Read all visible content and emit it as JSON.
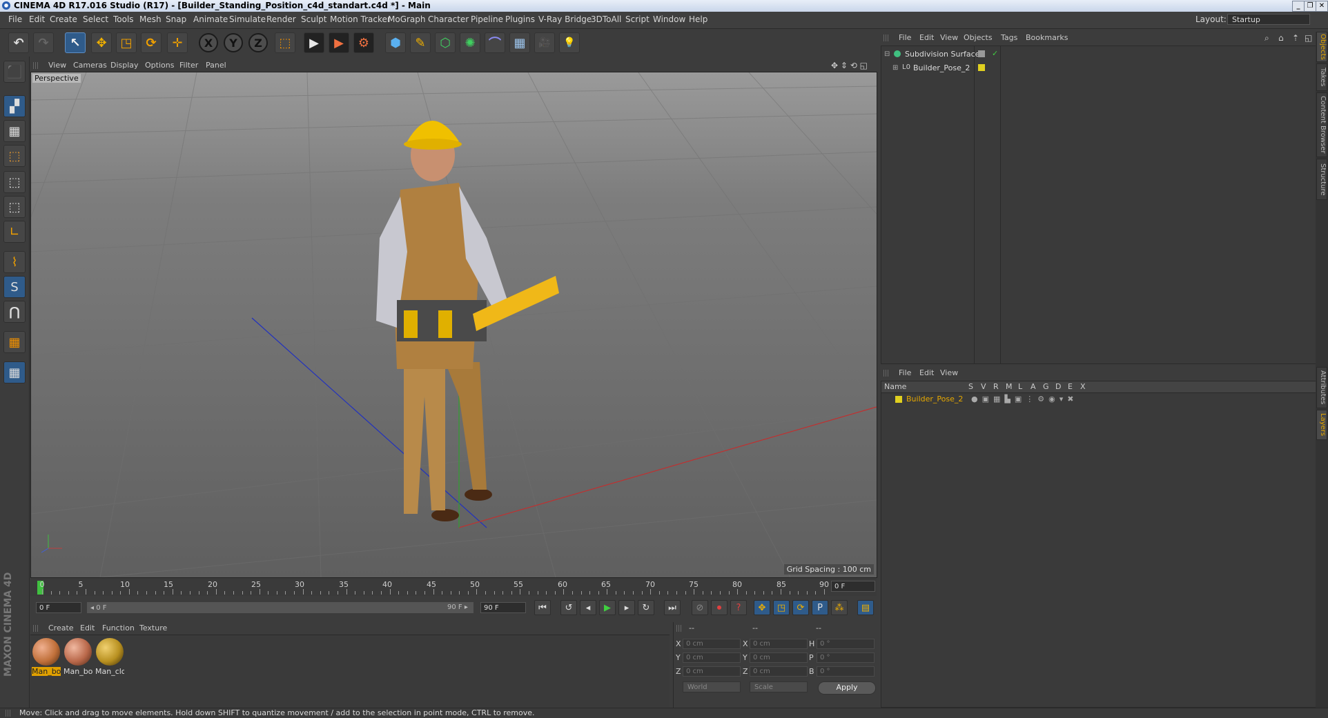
{
  "window": {
    "title": "CINEMA 4D R17.016 Studio (R17) - [Builder_Standing_Position_c4d_standart.c4d *] - Main",
    "min_label": "_",
    "max_label": "❐",
    "close_label": "✕"
  },
  "menubar": {
    "items": [
      "File",
      "Edit",
      "Create",
      "Select",
      "Tools",
      "Mesh",
      "Snap",
      "Animate",
      "Simulate",
      "Render",
      "Sculpt",
      "Motion Tracker",
      "MoGraph",
      "Character",
      "Pipeline",
      "Plugins",
      "V-Ray Bridge",
      "3DToAll",
      "Script",
      "Window",
      "Help"
    ],
    "layout_label": "Layout:",
    "layout_value": "Startup"
  },
  "toolbar": {
    "undo": "↶",
    "redo": "↷",
    "select": "↖",
    "move": "✥",
    "scale": "◳",
    "rotate": "⟳",
    "live": "✛",
    "x": "X",
    "y": "Y",
    "z": "Z",
    "coord": "⬚",
    "render_view": "▶",
    "render_pic": "▶",
    "render_settings": "⚙",
    "cube": "⬢",
    "pen": "✎",
    "subdiv": "⬡",
    "array": "✺",
    "deformer": "⌒",
    "floor": "▦",
    "camera": "🎥",
    "light": "💡"
  },
  "leftbar": [
    "⬛",
    "▞",
    "▦",
    "⬚",
    "⬚",
    "⬚",
    "∟",
    "⌇",
    "S",
    "⋂",
    "▦",
    "▦"
  ],
  "viewport": {
    "menu": [
      "View",
      "Cameras",
      "Display",
      "Options",
      "Filter",
      "Panel"
    ],
    "label": "Perspective",
    "grid_spacing": "Grid Spacing : 100 cm",
    "nav_icons": "✥ ⇕ ⟲ ◱"
  },
  "timeline": {
    "ticks": [
      0,
      5,
      10,
      15,
      20,
      25,
      30,
      35,
      40,
      45,
      50,
      55,
      60,
      65,
      70,
      75,
      80,
      85,
      90
    ],
    "current_frame": "0 F",
    "start_field": "0 F",
    "range_start": "◂ 0 F",
    "range_end": "90 F ▸",
    "end_field": "90 F"
  },
  "transport": [
    "⏮",
    "↺",
    "◂",
    "▶",
    "▸",
    "↻",
    "⏭"
  ],
  "keys": [
    "⊘",
    "⏺",
    "?",
    "✥",
    "◳",
    "⟳",
    "P",
    "⁂",
    "▤"
  ],
  "materials": {
    "menu": [
      "Create",
      "Edit",
      "Function",
      "Texture"
    ],
    "items": [
      {
        "name": "Man_bod",
        "color": "#c0703a"
      },
      {
        "name": "Man_bod",
        "color": "#b9684a"
      },
      {
        "name": "Man_clot",
        "color": "#b89020"
      }
    ]
  },
  "coordinates": {
    "header": [
      "--",
      "--",
      "--"
    ],
    "rows": [
      {
        "a": "X",
        "av": "0 cm",
        "b": "X",
        "bv": "0 cm",
        "c": "H",
        "cv": "0 °"
      },
      {
        "a": "Y",
        "av": "0 cm",
        "b": "Y",
        "bv": "0 cm",
        "c": "P",
        "cv": "0 °"
      },
      {
        "a": "Z",
        "av": "0 cm",
        "b": "Z",
        "bv": "0 cm",
        "c": "B",
        "cv": "0 °"
      }
    ],
    "world": "World",
    "scale": "Scale",
    "apply": "Apply"
  },
  "status": "Move: Click and drag to move elements. Hold down SHIFT to quantize movement / add to the selection in point mode, CTRL to remove.",
  "objects": {
    "menu": [
      "File",
      "Edit",
      "View",
      "Objects",
      "Tags",
      "Bookmarks"
    ],
    "items": [
      {
        "name": "Subdivision Surface",
        "check": "✓"
      },
      {
        "name": "Builder_Pose_2",
        "check": ""
      }
    ]
  },
  "layers": {
    "menu": [
      "File",
      "Edit",
      "View"
    ],
    "columns": [
      "Name",
      "S",
      "V",
      "R",
      "M",
      "L",
      "A",
      "G",
      "D",
      "E",
      "X"
    ],
    "items": [
      {
        "name": "Builder_Pose_2"
      }
    ]
  },
  "vtabs": [
    "Objects",
    "Takes",
    "Content Browser",
    "Structure",
    "Attributes",
    "Layers"
  ],
  "brand": "MAXON CINEMA 4D",
  "colors": {
    "accent": "#e6a800",
    "selected_blue": "#2f5b8a"
  }
}
